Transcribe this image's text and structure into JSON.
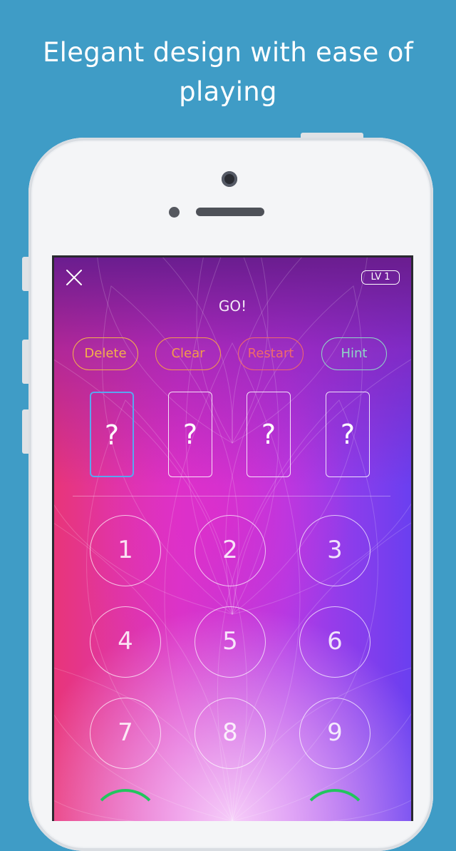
{
  "headline": {
    "line1": "Elegant design with ease of",
    "line2": "playing"
  },
  "game": {
    "level_badge": "LV 1",
    "status": "GO!",
    "controls": [
      {
        "label": "Delete",
        "color": "#f4b24a"
      },
      {
        "label": "Clear",
        "color": "#f29a4b"
      },
      {
        "label": "Restart",
        "color": "#ef6a6a"
      },
      {
        "label": "Hint",
        "color": "#8fd6c6"
      }
    ],
    "slots": [
      "?",
      "?",
      "?",
      "?"
    ],
    "keypad": [
      "1",
      "2",
      "3",
      "4",
      "5",
      "6",
      "7",
      "8",
      "9"
    ],
    "icons": {
      "close": "close-icon"
    },
    "accent": {
      "active_slot": "#5aa6f0",
      "ring": "#22c55e"
    }
  }
}
